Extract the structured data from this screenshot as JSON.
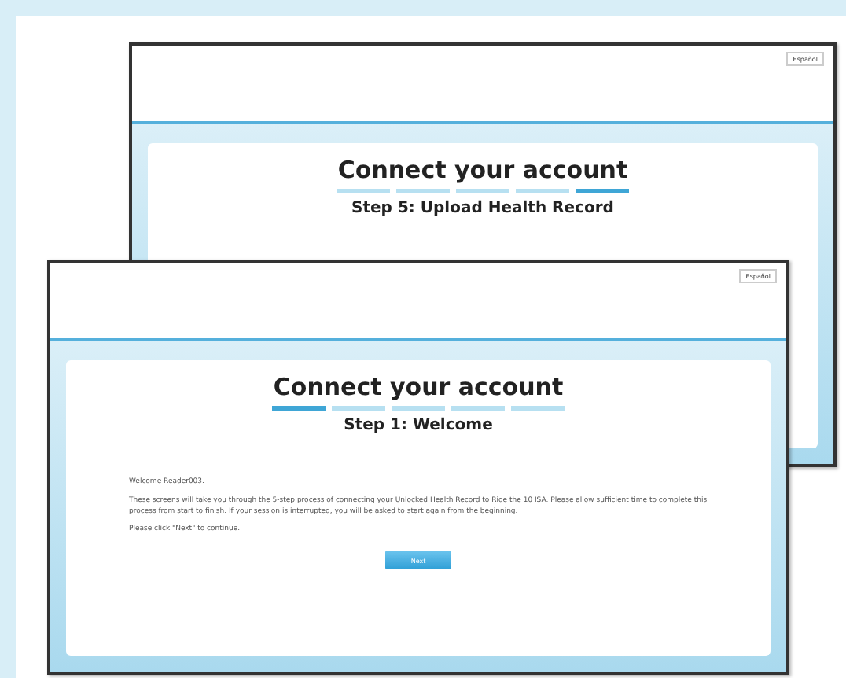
{
  "screens": [
    {
      "language_button": "Español",
      "title": "Connect your account",
      "steps": [
        {
          "selected": false
        },
        {
          "selected": false
        },
        {
          "selected": false
        },
        {
          "selected": false
        },
        {
          "selected": true
        }
      ],
      "step_title": "Step 5: Upload Health Record"
    },
    {
      "language_button": "Español",
      "title": "Connect your account",
      "steps": [
        {
          "selected": true
        },
        {
          "selected": false
        },
        {
          "selected": false
        },
        {
          "selected": false
        },
        {
          "selected": false
        }
      ],
      "step_title": "Step 1: Welcome",
      "paragraphs": [
        "Welcome Reader003.",
        "These screens will take you through the 5-step process of connecting your Unlocked Health Record to Ride the 10 ISA. Please allow sufficient time to complete this process from start to finish. If your session is interrupted, you will be asked to start again from the beginning.",
        "Please click \"Next\" to continue."
      ],
      "button": "Next"
    }
  ]
}
